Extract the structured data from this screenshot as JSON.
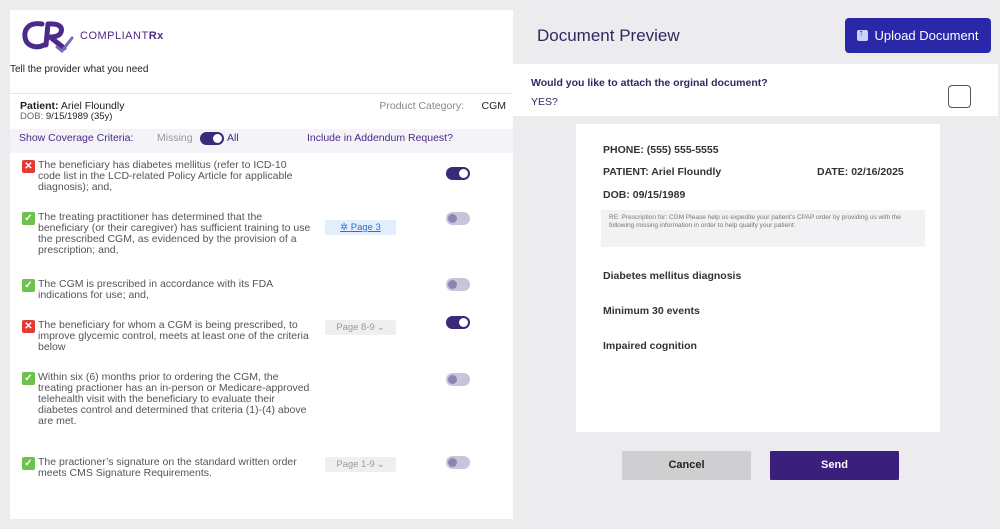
{
  "brand": {
    "name_part1": "COMPLIANT",
    "name_part2": "Rx"
  },
  "request": {
    "heading": "Tell the provider what you need",
    "patient_label": "Patient:",
    "patient_name": "Ariel Floundly",
    "dob_label": "DOB:",
    "dob_value": "9/15/1989 (35y)",
    "product_category_label": "Product Category:",
    "product_category_value": "CGM"
  },
  "coverage": {
    "label": "Show Coverage Criteria:",
    "missing_label": "Missing",
    "all_label": "All",
    "toggle_on": true,
    "include_label": "Include in Addendum Request?"
  },
  "criteria": [
    {
      "status": "missing",
      "text": "The beneficiary has diabetes mellitus (refer to ICD-10 code list in the LCD-related Policy Article for applicable diagnosis); and,",
      "page": "",
      "include": true
    },
    {
      "status": "met",
      "text": "The treating practitioner has determined that the beneficiary (or their caregiver) has sufficient training to use the prescribed CGM, as evidenced by the provision of a prescription; and,",
      "page": "Page 3",
      "include": false
    },
    {
      "status": "met",
      "text": "The CGM is prescribed in accordance with its FDA indications for use; and,",
      "page": "",
      "include": false
    },
    {
      "status": "missing",
      "text": "The beneficiary for whom a CGM is being prescribed, to improve glycemic control, meets at least one of the criteria below",
      "page": "Page 8-9",
      "include": true
    },
    {
      "status": "met",
      "text": "Within six (6) months prior to ordering the CGM, the treating practioner has an in-person or Medicare-approved telehealth visit with the beneficiary to evaluate their diabetes control and determined that criteria (1)-(4) above are met.",
      "page": "",
      "include": false
    },
    {
      "status": "met",
      "text": "The practioner’s signature on the standard written order meets CMS Signature Requirements.",
      "page": "Page 1-9",
      "include": false
    }
  ],
  "preview": {
    "title": "Document Preview",
    "upload_label": "Upload Document",
    "attach_question": "Would you like to attach the orginal document?",
    "attach_answer": "YES?",
    "phone": "PHONE: (555) 555-5555",
    "patient": "PATIENT: Ariel Floundly",
    "date": "DATE: 02/16/2025",
    "dob": "DOB: 09/15/1989",
    "note": "RE: Prescription for: CGM Please help us expedite your patient’s CPAP order by providing us with the following missing information in order to help qualify your patient:",
    "items": [
      "Diabetes mellitus diagnosis",
      "Minimum 30 events",
      "Impaired cognition"
    ],
    "cancel_label": "Cancel",
    "send_label": "Send"
  },
  "colors": {
    "accent": "#3b2a78",
    "upload": "#2a27a8",
    "missing": "#e53935",
    "met": "#6cc24a",
    "send": "#3b1f7d"
  },
  "icons": {
    "missing": "x-icon",
    "met": "check-icon",
    "page_link": "puzzle-icon",
    "page_dropdown": "chevron-down-icon",
    "upload": "upload-icon"
  }
}
